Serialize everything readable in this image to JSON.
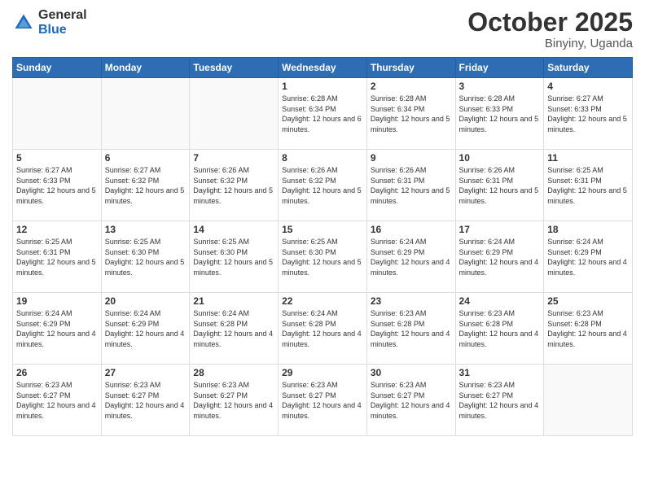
{
  "logo": {
    "general": "General",
    "blue": "Blue"
  },
  "title": "October 2025",
  "location": "Binyiny, Uganda",
  "weekdays": [
    "Sunday",
    "Monday",
    "Tuesday",
    "Wednesday",
    "Thursday",
    "Friday",
    "Saturday"
  ],
  "weeks": [
    [
      {
        "day": "",
        "info": ""
      },
      {
        "day": "",
        "info": ""
      },
      {
        "day": "",
        "info": ""
      },
      {
        "day": "1",
        "info": "Sunrise: 6:28 AM\nSunset: 6:34 PM\nDaylight: 12 hours\nand 6 minutes."
      },
      {
        "day": "2",
        "info": "Sunrise: 6:28 AM\nSunset: 6:34 PM\nDaylight: 12 hours\nand 5 minutes."
      },
      {
        "day": "3",
        "info": "Sunrise: 6:28 AM\nSunset: 6:33 PM\nDaylight: 12 hours\nand 5 minutes."
      },
      {
        "day": "4",
        "info": "Sunrise: 6:27 AM\nSunset: 6:33 PM\nDaylight: 12 hours\nand 5 minutes."
      }
    ],
    [
      {
        "day": "5",
        "info": "Sunrise: 6:27 AM\nSunset: 6:33 PM\nDaylight: 12 hours\nand 5 minutes."
      },
      {
        "day": "6",
        "info": "Sunrise: 6:27 AM\nSunset: 6:32 PM\nDaylight: 12 hours\nand 5 minutes."
      },
      {
        "day": "7",
        "info": "Sunrise: 6:26 AM\nSunset: 6:32 PM\nDaylight: 12 hours\nand 5 minutes."
      },
      {
        "day": "8",
        "info": "Sunrise: 6:26 AM\nSunset: 6:32 PM\nDaylight: 12 hours\nand 5 minutes."
      },
      {
        "day": "9",
        "info": "Sunrise: 6:26 AM\nSunset: 6:31 PM\nDaylight: 12 hours\nand 5 minutes."
      },
      {
        "day": "10",
        "info": "Sunrise: 6:26 AM\nSunset: 6:31 PM\nDaylight: 12 hours\nand 5 minutes."
      },
      {
        "day": "11",
        "info": "Sunrise: 6:25 AM\nSunset: 6:31 PM\nDaylight: 12 hours\nand 5 minutes."
      }
    ],
    [
      {
        "day": "12",
        "info": "Sunrise: 6:25 AM\nSunset: 6:31 PM\nDaylight: 12 hours\nand 5 minutes."
      },
      {
        "day": "13",
        "info": "Sunrise: 6:25 AM\nSunset: 6:30 PM\nDaylight: 12 hours\nand 5 minutes."
      },
      {
        "day": "14",
        "info": "Sunrise: 6:25 AM\nSunset: 6:30 PM\nDaylight: 12 hours\nand 5 minutes."
      },
      {
        "day": "15",
        "info": "Sunrise: 6:25 AM\nSunset: 6:30 PM\nDaylight: 12 hours\nand 5 minutes."
      },
      {
        "day": "16",
        "info": "Sunrise: 6:24 AM\nSunset: 6:29 PM\nDaylight: 12 hours\nand 4 minutes."
      },
      {
        "day": "17",
        "info": "Sunrise: 6:24 AM\nSunset: 6:29 PM\nDaylight: 12 hours\nand 4 minutes."
      },
      {
        "day": "18",
        "info": "Sunrise: 6:24 AM\nSunset: 6:29 PM\nDaylight: 12 hours\nand 4 minutes."
      }
    ],
    [
      {
        "day": "19",
        "info": "Sunrise: 6:24 AM\nSunset: 6:29 PM\nDaylight: 12 hours\nand 4 minutes."
      },
      {
        "day": "20",
        "info": "Sunrise: 6:24 AM\nSunset: 6:29 PM\nDaylight: 12 hours\nand 4 minutes."
      },
      {
        "day": "21",
        "info": "Sunrise: 6:24 AM\nSunset: 6:28 PM\nDaylight: 12 hours\nand 4 minutes."
      },
      {
        "day": "22",
        "info": "Sunrise: 6:24 AM\nSunset: 6:28 PM\nDaylight: 12 hours\nand 4 minutes."
      },
      {
        "day": "23",
        "info": "Sunrise: 6:23 AM\nSunset: 6:28 PM\nDaylight: 12 hours\nand 4 minutes."
      },
      {
        "day": "24",
        "info": "Sunrise: 6:23 AM\nSunset: 6:28 PM\nDaylight: 12 hours\nand 4 minutes."
      },
      {
        "day": "25",
        "info": "Sunrise: 6:23 AM\nSunset: 6:28 PM\nDaylight: 12 hours\nand 4 minutes."
      }
    ],
    [
      {
        "day": "26",
        "info": "Sunrise: 6:23 AM\nSunset: 6:27 PM\nDaylight: 12 hours\nand 4 minutes."
      },
      {
        "day": "27",
        "info": "Sunrise: 6:23 AM\nSunset: 6:27 PM\nDaylight: 12 hours\nand 4 minutes."
      },
      {
        "day": "28",
        "info": "Sunrise: 6:23 AM\nSunset: 6:27 PM\nDaylight: 12 hours\nand 4 minutes."
      },
      {
        "day": "29",
        "info": "Sunrise: 6:23 AM\nSunset: 6:27 PM\nDaylight: 12 hours\nand 4 minutes."
      },
      {
        "day": "30",
        "info": "Sunrise: 6:23 AM\nSunset: 6:27 PM\nDaylight: 12 hours\nand 4 minutes."
      },
      {
        "day": "31",
        "info": "Sunrise: 6:23 AM\nSunset: 6:27 PM\nDaylight: 12 hours\nand 4 minutes."
      },
      {
        "day": "",
        "info": ""
      }
    ]
  ]
}
